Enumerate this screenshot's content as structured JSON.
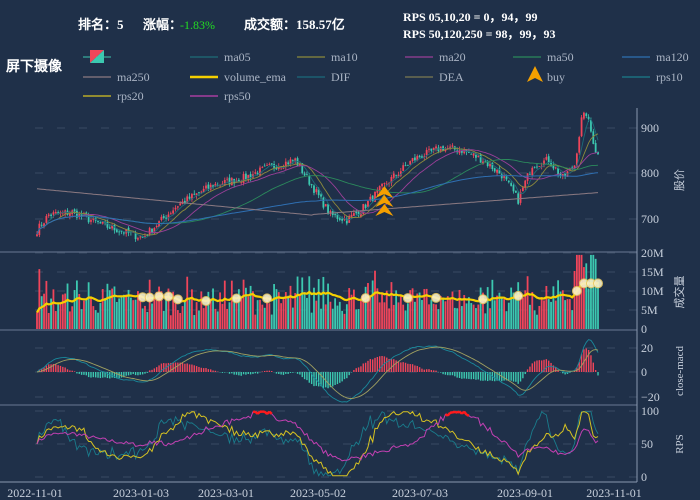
{
  "header": {
    "rank_label": "排名：5",
    "change_label": "涨幅：",
    "change_value": "-1.83%",
    "amount_label": "成交额：158.57亿",
    "rps_line1": "RPS 05,10,20 = 0，94，99",
    "rps_line2": "RPS 50,120,250 = 98，99，93",
    "stock_name": "屏下摄像"
  },
  "legend": [
    {
      "name": "",
      "kind": "candle"
    },
    {
      "name": "ma05",
      "color": "#1d6c78"
    },
    {
      "name": "ma10",
      "color": "#8c8a3c"
    },
    {
      "name": "ma20",
      "color": "#9b3f98"
    },
    {
      "name": "ma50",
      "color": "#2b8a5c"
    },
    {
      "name": "ma120",
      "color": "#2f6fb2"
    },
    {
      "name": "ma250",
      "color": "#8c7a82"
    },
    {
      "name": "volume_ema",
      "color": "#f5d000"
    },
    {
      "name": "DIF",
      "color": "#1a6a7c"
    },
    {
      "name": "DEA",
      "color": "#7c7a52"
    },
    {
      "name": "buy",
      "color": "#f5a000",
      "kind": "triangle"
    },
    {
      "name": "rps10",
      "color": "#1a7c8c"
    },
    {
      "name": "rps20",
      "color": "#d6c222"
    },
    {
      "name": "rps50",
      "color": "#c240b2"
    }
  ],
  "colors": {
    "up": "#f0455a",
    "down": "#3cc8b0",
    "background": "#1f3049",
    "grid": "#3a4a62",
    "axis": "#8a98b0"
  },
  "chart_data": {
    "type": "candlestick",
    "days": 240,
    "close_keypoints": [
      [
        0,
        673
      ],
      [
        5,
        707
      ],
      [
        15,
        713
      ],
      [
        28,
        684
      ],
      [
        45,
        656
      ],
      [
        60,
        729
      ],
      [
        75,
        773
      ],
      [
        88,
        789
      ],
      [
        98,
        811
      ],
      [
        110,
        829
      ],
      [
        117,
        773
      ],
      [
        125,
        707
      ],
      [
        132,
        696
      ],
      [
        138,
        718
      ],
      [
        148,
        773
      ],
      [
        160,
        829
      ],
      [
        172,
        856
      ],
      [
        181,
        851
      ],
      [
        190,
        829
      ],
      [
        198,
        796
      ],
      [
        205,
        740
      ],
      [
        211,
        818
      ],
      [
        218,
        829
      ],
      [
        224,
        789
      ],
      [
        229,
        818
      ],
      [
        232,
        918
      ],
      [
        234,
        933
      ],
      [
        238,
        851
      ],
      [
        239,
        840
      ]
    ],
    "buy_signal_days": [
      148
    ],
    "x_ticks": [
      "2022-11-01",
      "2023-01-03",
      "2023-03-01",
      "2023-05-02",
      "2023-07-03",
      "2023-09-01",
      "2023-11-01"
    ],
    "panels": [
      {
        "ylabel": "股价",
        "ticks": [
          "700",
          "800",
          "900"
        ],
        "ylim": [
          620,
          940
        ]
      },
      {
        "ylabel": "成交量",
        "ticks": [
          "0",
          "5M",
          "10M",
          "15M",
          "20M"
        ],
        "ylim": [
          0,
          20
        ]
      },
      {
        "ylabel": "close-macd",
        "ticks": [
          "−20",
          "0",
          "20"
        ],
        "ylim": [
          -25,
          30
        ]
      },
      {
        "ylabel": "RPS",
        "ticks": [
          "0",
          "50",
          "100"
        ],
        "ylim": [
          0,
          100
        ]
      }
    ]
  }
}
